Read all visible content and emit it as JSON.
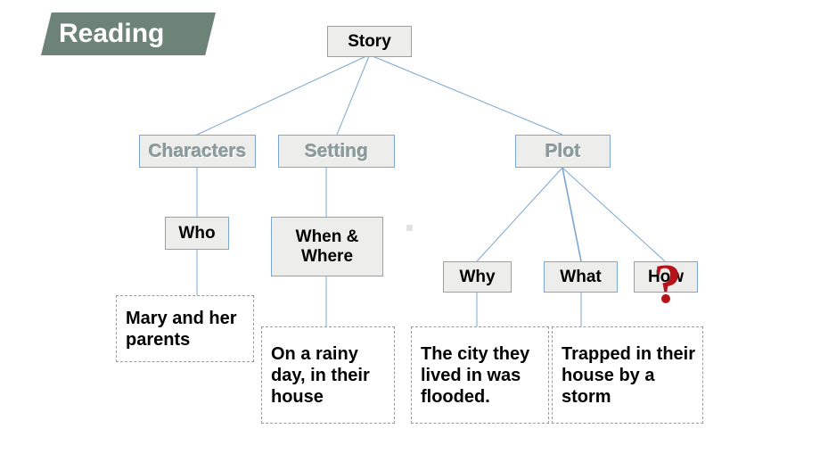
{
  "banner": {
    "label": "Reading",
    "fill_color": "#6E8378",
    "text_color": "#FFFFFF"
  },
  "colors": {
    "node_fill": "#EDEDEB",
    "node_border": "#7BA7D0",
    "connector": "#7BA7D0",
    "gray_text": "#8C9C9C",
    "answer_border": "#9A9A9A",
    "question_mark": "#B41419"
  },
  "diagram": {
    "root": {
      "label": "Story"
    },
    "branches": [
      {
        "label": "Characters"
      },
      {
        "label": "Setting"
      },
      {
        "label": "Plot"
      }
    ],
    "questions": [
      {
        "label": "Who"
      },
      {
        "label": "When & Where"
      },
      {
        "label": "Why"
      },
      {
        "label": "What"
      },
      {
        "label": "How"
      }
    ],
    "answers": [
      {
        "text": "Mary and her parents"
      },
      {
        "text": "On a rainy day, in their house"
      },
      {
        "text": "The city they lived in was flooded."
      },
      {
        "text": "Trapped in their house by a storm"
      }
    ],
    "marker": {
      "glyph": "?"
    }
  }
}
